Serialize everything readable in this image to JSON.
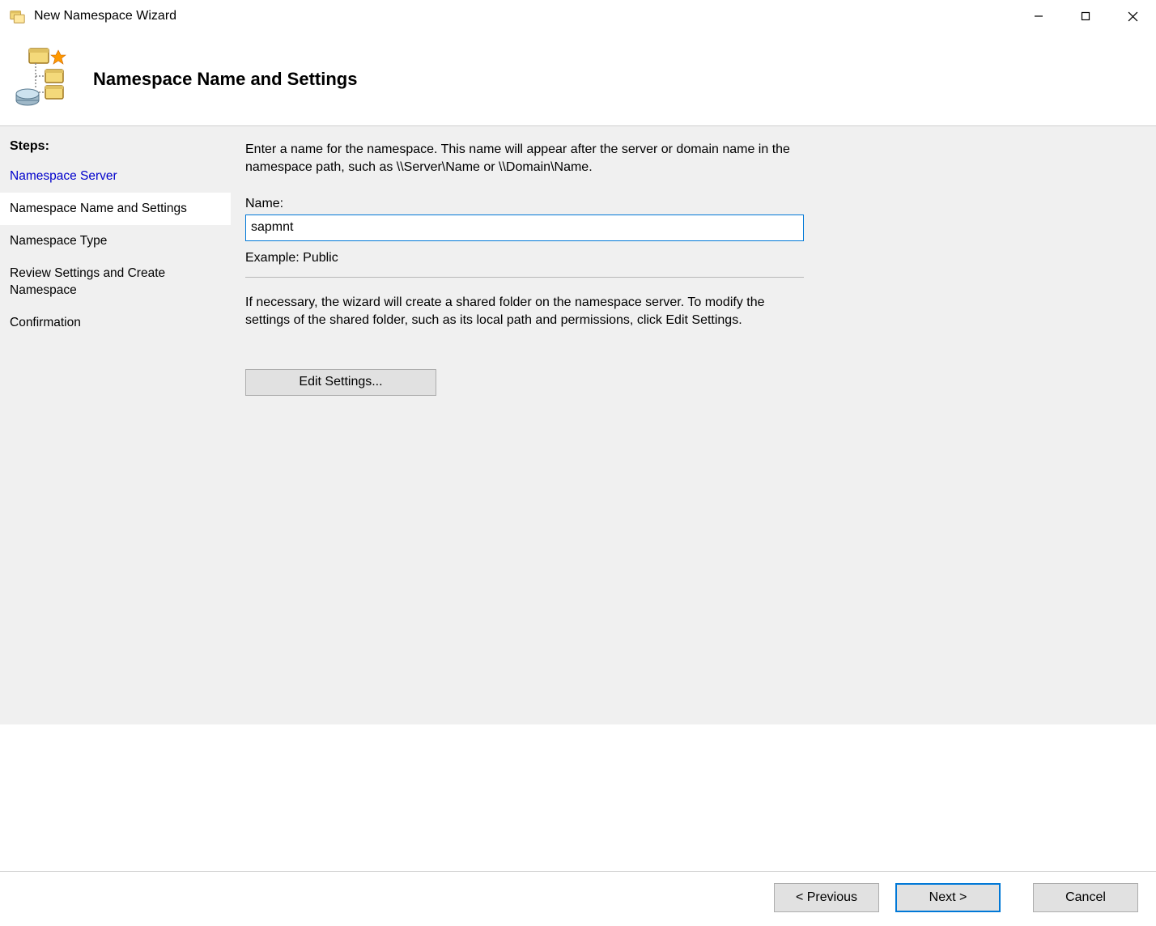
{
  "window": {
    "title": "New Namespace Wizard"
  },
  "header": {
    "heading": "Namespace Name and Settings"
  },
  "steps": {
    "label": "Steps:",
    "items": [
      {
        "label": "Namespace Server",
        "state": "completed"
      },
      {
        "label": "Namespace Name and Settings",
        "state": "active"
      },
      {
        "label": "Namespace Type",
        "state": "pending"
      },
      {
        "label": "Review Settings and Create Namespace",
        "state": "pending"
      },
      {
        "label": "Confirmation",
        "state": "pending"
      }
    ]
  },
  "main": {
    "instruction": "Enter a name for the namespace. This name will appear after the server or domain name in the namespace path, such as \\\\Server\\Name or \\\\Domain\\Name.",
    "name_label": "Name:",
    "name_value": "sapmnt",
    "example_text": "Example: Public",
    "helper_text": "If necessary, the wizard will create a shared folder on the namespace server. To modify the settings of the shared folder, such as its local path and permissions, click Edit Settings.",
    "edit_settings_label": "Edit Settings..."
  },
  "footer": {
    "previous": "< Previous",
    "next": "Next >",
    "cancel": "Cancel"
  }
}
